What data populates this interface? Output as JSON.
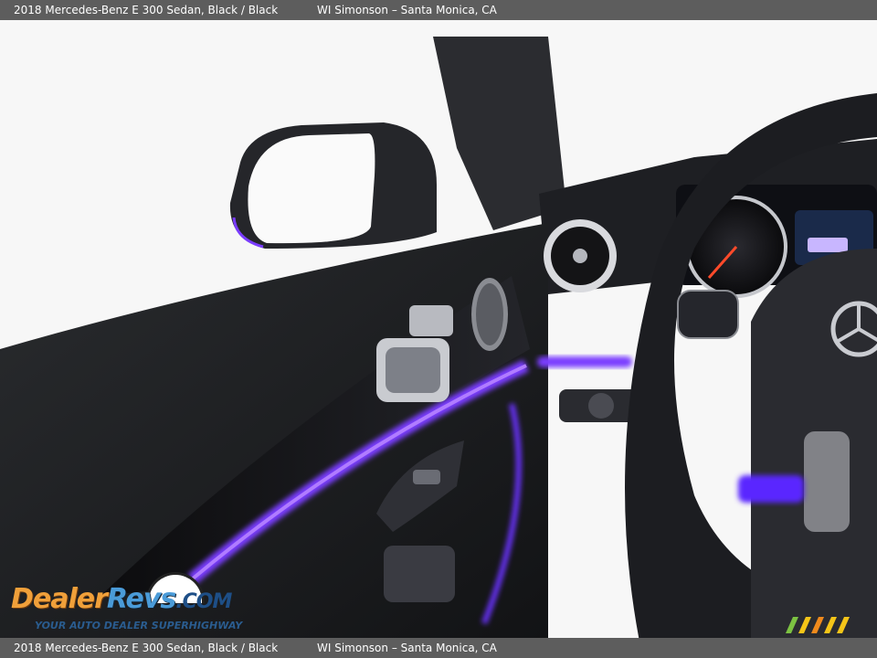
{
  "caption": {
    "car": "2018 Mercedes-Benz E 300 Sedan,  Black / Black",
    "dealer": "WI Simonson – Santa Monica, CA"
  },
  "photo": {
    "subject": "Driver door interior panel with purple ambient lighting, side mirror, air vent, steering wheel and instrument cluster",
    "ambient_light_color": "#7a3cff",
    "panel_color": "#1b1c1e"
  },
  "watermark": {
    "logo_dealer": "Dealer",
    "logo_revs": "Revs",
    "logo_com": ".COM",
    "tagline": "YOUR AUTO DEALER SUPERHIGHWAY"
  }
}
